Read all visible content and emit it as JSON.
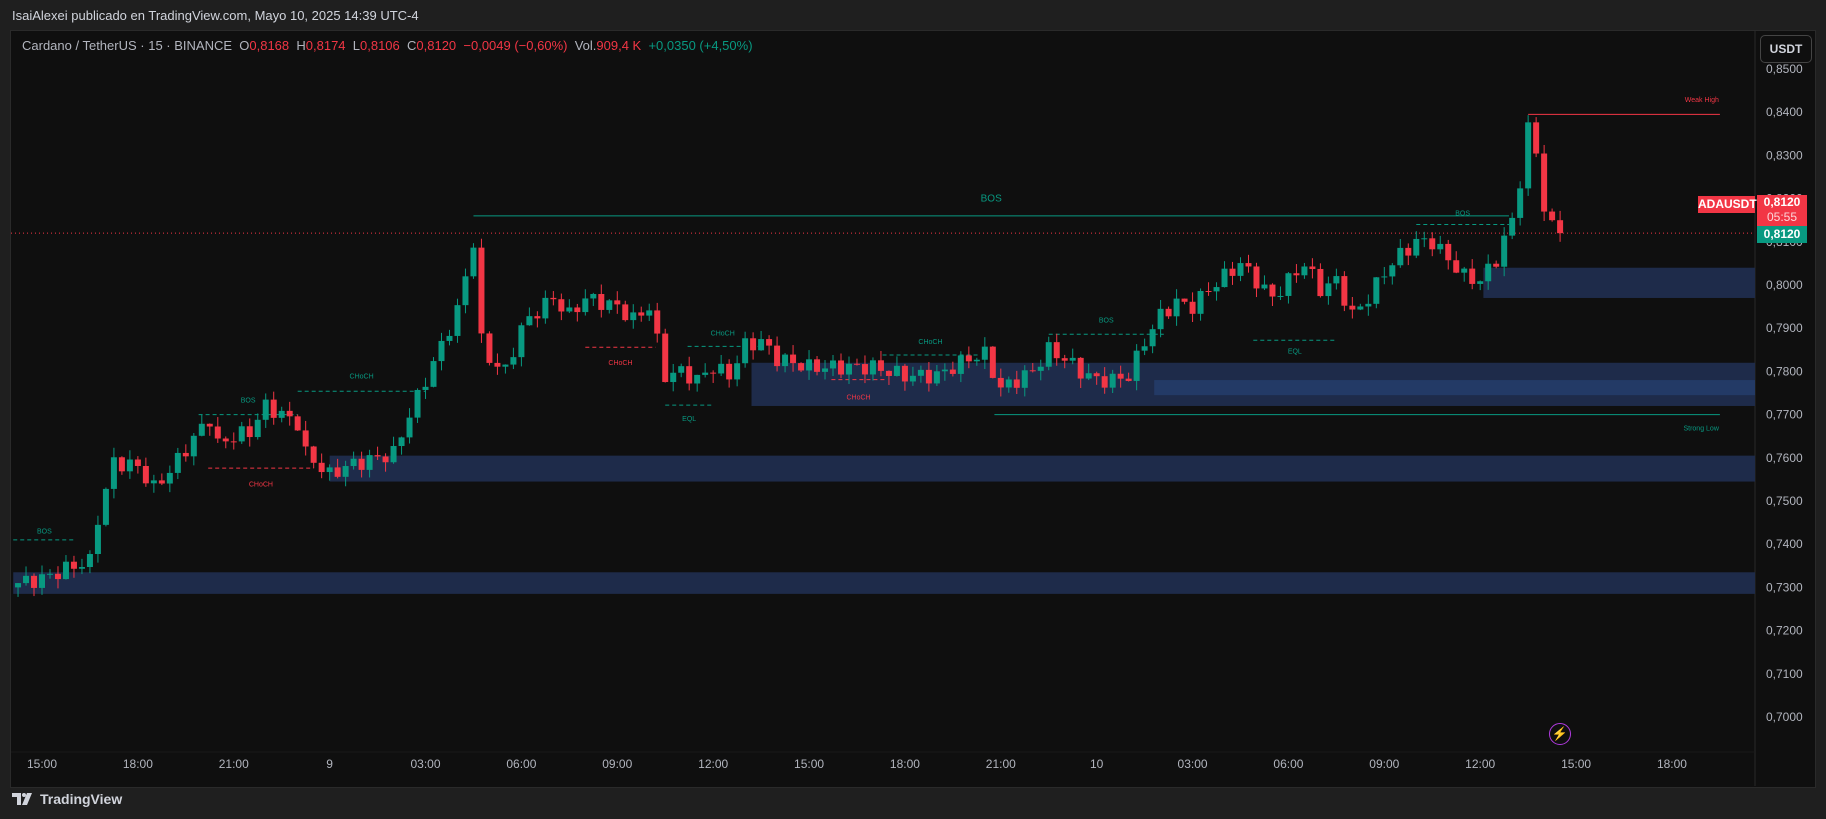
{
  "header": {
    "published": "IsaiAlexei publicado en TradingView.com, Mayo 10, 2025 14:39 UTC-4"
  },
  "legend": {
    "symbol": "Cardano / TetherUS · 15 · BINANCE",
    "o_label": "O",
    "o": "0,8168",
    "h_label": "H",
    "h": "0,8174",
    "l_label": "L",
    "l": "0,8106",
    "c_label": "C",
    "c": "0,8120",
    "change": "−0,0049 (−0,60%)",
    "vol_label": "Vol.",
    "vol": "909,4 K",
    "vol_change": "+0,0350 (+4,50%)"
  },
  "currency_button": "USDT",
  "price_tags": {
    "symbol": "ADAUSDT",
    "price": "0,8120",
    "countdown": "05:55",
    "last": "0,8120"
  },
  "footer": {
    "brand": "TradingView"
  },
  "colors": {
    "up": "#089981",
    "down": "#f23645",
    "zone": "#1e2b4a",
    "zone_inner": "#233a66"
  },
  "chart_data": {
    "type": "candlestick",
    "ylim": [
      0.7,
      0.85
    ],
    "y_ticks": [
      "0,8500",
      "0,8400",
      "0,8300",
      "0,8200",
      "0,8100",
      "0,8000",
      "0,7900",
      "0,7800",
      "0,7700",
      "0,7600",
      "0,7500",
      "0,7400",
      "0,7300",
      "0,7200",
      "0,7100",
      "0,7000"
    ],
    "x_ticks": [
      "15:00",
      "18:00",
      "21:00",
      "9",
      "03:00",
      "06:00",
      "09:00",
      "12:00",
      "15:00",
      "18:00",
      "21:00",
      "10",
      "03:00",
      "06:00",
      "09:00",
      "12:00",
      "15:00",
      "18:00"
    ],
    "x_tick_step_hours": 3,
    "last_price": 0.812,
    "price_path_hours_from_15h": [
      [
        -0.75,
        0.731
      ],
      [
        0,
        0.732
      ],
      [
        1,
        0.735
      ],
      [
        1.5,
        0.736
      ],
      [
        1.75,
        0.746
      ],
      [
        2.25,
        0.759
      ],
      [
        3,
        0.758
      ],
      [
        3.5,
        0.753
      ],
      [
        4,
        0.757
      ],
      [
        5,
        0.767
      ],
      [
        5.25,
        0.769
      ],
      [
        5.5,
        0.763
      ],
      [
        6,
        0.765
      ],
      [
        6.5,
        0.766
      ],
      [
        7,
        0.772
      ],
      [
        7.5,
        0.77
      ],
      [
        8,
        0.768
      ],
      [
        8.25,
        0.761
      ],
      [
        9,
        0.756
      ],
      [
        9.5,
        0.758
      ],
      [
        10,
        0.759
      ],
      [
        11,
        0.761
      ],
      [
        11.5,
        0.77
      ],
      [
        12,
        0.778
      ],
      [
        12.5,
        0.786
      ],
      [
        13,
        0.794
      ],
      [
        13.5,
        0.81
      ],
      [
        13.75,
        0.787
      ],
      [
        14,
        0.783
      ],
      [
        14.5,
        0.78
      ],
      [
        15,
        0.79
      ],
      [
        15.5,
        0.794
      ],
      [
        16,
        0.797
      ],
      [
        16.5,
        0.793
      ],
      [
        17,
        0.797
      ],
      [
        18,
        0.795
      ],
      [
        18.5,
        0.792
      ],
      [
        19,
        0.795
      ],
      [
        19.5,
        0.779
      ],
      [
        20,
        0.78
      ],
      [
        20.5,
        0.778
      ],
      [
        21,
        0.781
      ],
      [
        21.5,
        0.779
      ],
      [
        22,
        0.786
      ],
      [
        22.5,
        0.787
      ],
      [
        23,
        0.783
      ],
      [
        24,
        0.781
      ],
      [
        25,
        0.781
      ],
      [
        26,
        0.781
      ],
      [
        27,
        0.779
      ],
      [
        28,
        0.779
      ],
      [
        29,
        0.783
      ],
      [
        29.5,
        0.784
      ],
      [
        30,
        0.776
      ],
      [
        30.5,
        0.778
      ],
      [
        31,
        0.78
      ],
      [
        31.5,
        0.785
      ],
      [
        32,
        0.783
      ],
      [
        32.5,
        0.78
      ],
      [
        33,
        0.778
      ],
      [
        33.5,
        0.778
      ],
      [
        34,
        0.779
      ],
      [
        34.5,
        0.787
      ],
      [
        35,
        0.793
      ],
      [
        35.5,
        0.796
      ],
      [
        36,
        0.795
      ],
      [
        36.5,
        0.799
      ],
      [
        37,
        0.802
      ],
      [
        37.5,
        0.805
      ],
      [
        38,
        0.801
      ],
      [
        38.5,
        0.797
      ],
      [
        39,
        0.801
      ],
      [
        39.5,
        0.805
      ],
      [
        40,
        0.799
      ],
      [
        40.5,
        0.801
      ],
      [
        41,
        0.793
      ],
      [
        41.5,
        0.797
      ],
      [
        42,
        0.803
      ],
      [
        42.5,
        0.807
      ],
      [
        43,
        0.81
      ],
      [
        43.5,
        0.81
      ],
      [
        44,
        0.806
      ],
      [
        44.5,
        0.802
      ],
      [
        45,
        0.801
      ],
      [
        45.5,
        0.806
      ],
      [
        46,
        0.815
      ],
      [
        46.25,
        0.824
      ],
      [
        46.5,
        0.836
      ],
      [
        46.75,
        0.831
      ],
      [
        47,
        0.817
      ],
      [
        47.25,
        0.815
      ],
      [
        47.5,
        0.812
      ]
    ],
    "zones": [
      {
        "low": 0.7285,
        "high": 0.7335,
        "from_h": -0.9
      },
      {
        "low": 0.7545,
        "high": 0.7605,
        "from_h": 9.0
      },
      {
        "low": 0.772,
        "high": 0.782,
        "from_h": 22.2
      },
      {
        "low": 0.7745,
        "high": 0.778,
        "from_h": 34.8,
        "inner": true
      },
      {
        "low": 0.797,
        "high": 0.804,
        "from_h": 45.1
      }
    ],
    "structures": [
      {
        "label": "BOS",
        "price": 0.741,
        "from_h": -0.9,
        "to_h": 1.05,
        "label_price": 0.7432,
        "color": "up",
        "dashed": true
      },
      {
        "label": "BOS",
        "price": 0.77,
        "from_h": 4.9,
        "to_h": 8.0,
        "label_price": 0.7735,
        "color": "up",
        "dashed": true
      },
      {
        "label": "CHoCH",
        "price": 0.7576,
        "from_h": 5.2,
        "to_h": 8.5,
        "label_price": 0.754,
        "color": "down",
        "dashed": true
      },
      {
        "label": "CHoCH",
        "price": 0.7754,
        "from_h": 8.0,
        "to_h": 12.0,
        "label_price": 0.779,
        "color": "up",
        "dashed": true
      },
      {
        "label": "CHoCH",
        "price": 0.7856,
        "from_h": 17.0,
        "to_h": 19.2,
        "label_price": 0.7822,
        "color": "down",
        "dashed": true
      },
      {
        "label": "CHoCH",
        "price": 0.7858,
        "from_h": 20.2,
        "to_h": 22.4,
        "label_price": 0.789,
        "color": "up",
        "dashed": true
      },
      {
        "label": "EQL",
        "price": 0.7722,
        "from_h": 19.5,
        "to_h": 21.0,
        "label_price": 0.7692,
        "color": "up",
        "dashed": true
      },
      {
        "label": "CHoCH",
        "price": 0.7781,
        "from_h": 24.7,
        "to_h": 26.4,
        "label_price": 0.7742,
        "color": "down",
        "dashed": true
      },
      {
        "label": "CHoCH",
        "price": 0.7838,
        "from_h": 26.3,
        "to_h": 29.3,
        "label_price": 0.787,
        "color": "up",
        "dashed": true
      },
      {
        "label": "BOS",
        "price": 0.7886,
        "from_h": 31.5,
        "to_h": 35.1,
        "label_price": 0.792,
        "color": "up",
        "dashed": true
      },
      {
        "label": "EQL",
        "price": 0.7872,
        "from_h": 37.9,
        "to_h": 40.5,
        "label_price": 0.7848,
        "color": "up",
        "dashed": true
      },
      {
        "label": "BOS",
        "price": 0.814,
        "from_h": 43.0,
        "to_h": 45.9,
        "label_price": 0.8168,
        "color": "up",
        "dashed": true
      },
      {
        "label": "BOS",
        "price": 0.816,
        "from_h": 13.5,
        "to_h": 45.9,
        "label_price": 0.82,
        "color": "up",
        "dashed": false,
        "big": true
      },
      {
        "label": "Weak High",
        "price": 0.8395,
        "from_h": 46.5,
        "to_h": 52.5,
        "label_price": 0.843,
        "color": "down",
        "dashed": false,
        "right_label": true
      },
      {
        "label": "Strong Low",
        "price": 0.77,
        "from_h": 29.8,
        "to_h": 52.5,
        "label_price": 0.767,
        "color": "up",
        "dashed": false,
        "right_label": true
      }
    ]
  }
}
